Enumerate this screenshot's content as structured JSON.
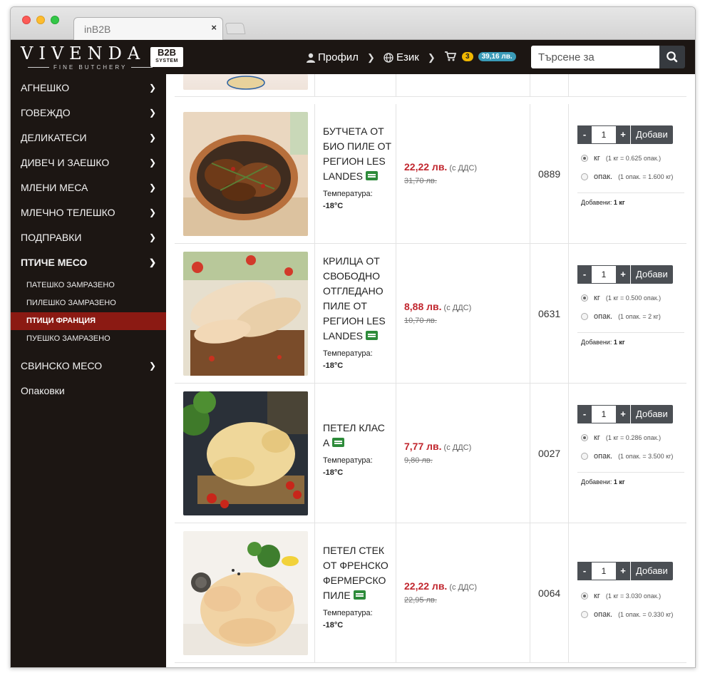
{
  "browser": {
    "tab_title": "inB2B",
    "tab_close": "×"
  },
  "header": {
    "logo": "VIVENDA",
    "logo_sub": "FINE BUTCHERY",
    "b2b_main": "B2B",
    "b2b_sub": "SYSTEM",
    "profile": "Профил",
    "language": "Език",
    "cart_count": "3",
    "cart_total": "39,16 лв.",
    "search_placeholder": "Търсене за"
  },
  "sidebar": {
    "categories": [
      {
        "label": "АГНЕШКО"
      },
      {
        "label": "ГОВЕЖДО"
      },
      {
        "label": "ДЕЛИКАТЕСИ"
      },
      {
        "label": "ДИВЕЧ И ЗАЕШКО"
      },
      {
        "label": "МЛЕНИ МЕСА"
      },
      {
        "label": "МЛЕЧНО ТЕЛЕШКО"
      },
      {
        "label": "ПОДПРАВКИ"
      },
      {
        "label": "ПТИЧЕ МЕСО"
      }
    ],
    "subcategories": [
      {
        "label": "ПАТЕШКО ЗАМРАЗЕНО"
      },
      {
        "label": "ПИЛЕШКО ЗАМРАЗЕНО"
      },
      {
        "label": "ПТИЦИ ФРАНЦИЯ"
      },
      {
        "label": "ПУЕШКО ЗАМРАЗЕНО"
      }
    ],
    "after": [
      {
        "label": "СВИНСКО МЕСО"
      },
      {
        "label": "Опаковки"
      }
    ]
  },
  "common": {
    "vat": "(с ДДС)",
    "temp_label": "Температура:",
    "add_button": "Добави",
    "minus": "-",
    "plus": "+",
    "unit_kg": "кг",
    "unit_pack": "опак.",
    "added_label": "Добавени:"
  },
  "products": [
    {
      "name": "БУТЧЕТА ОТ БИО ПИЛЕ ОТ РЕГИОН LES LANDES",
      "temp": "-18°C",
      "price": "22,22 лв.",
      "old_price": "31,70 лв.",
      "code": "0889",
      "qty": "1",
      "kg_hint": "(1 кг = 0.625 опак.)",
      "pack_hint": "(1 опак. = 1.600 кг)",
      "added": "1 кг"
    },
    {
      "name": "КРИЛЦА ОТ СВОБОДНО ОТГЛЕДАНО ПИЛЕ ОТ РЕГИОН LES LANDES",
      "temp": "-18°C",
      "price": "8,88 лв.",
      "old_price": "10,70 лв.",
      "code": "0631",
      "qty": "1",
      "kg_hint": "(1 кг = 0.500 опак.)",
      "pack_hint": "(1 опак. = 2 кг)",
      "added": "1 кг"
    },
    {
      "name": "ПЕТЕЛ КЛАС А",
      "temp": "-18°C",
      "price": "7,77 лв.",
      "old_price": "9,80 лв.",
      "code": "0027",
      "qty": "1",
      "kg_hint": "(1 кг = 0.286 опак.)",
      "pack_hint": "(1 опак. = 3.500 кг)",
      "added": "1 кг"
    },
    {
      "name": "ПЕТЕЛ СТЕК ОТ ФРЕНСКО ФЕРМЕРСКО ПИЛЕ",
      "temp": "-18°C",
      "price": "22,22 лв.",
      "old_price": "22,95 лв.",
      "code": "0064",
      "qty": "1",
      "kg_hint": "(1 кг = 3.030 опак.)",
      "pack_hint": "(1 опак. = 0.330 кг)"
    }
  ]
}
